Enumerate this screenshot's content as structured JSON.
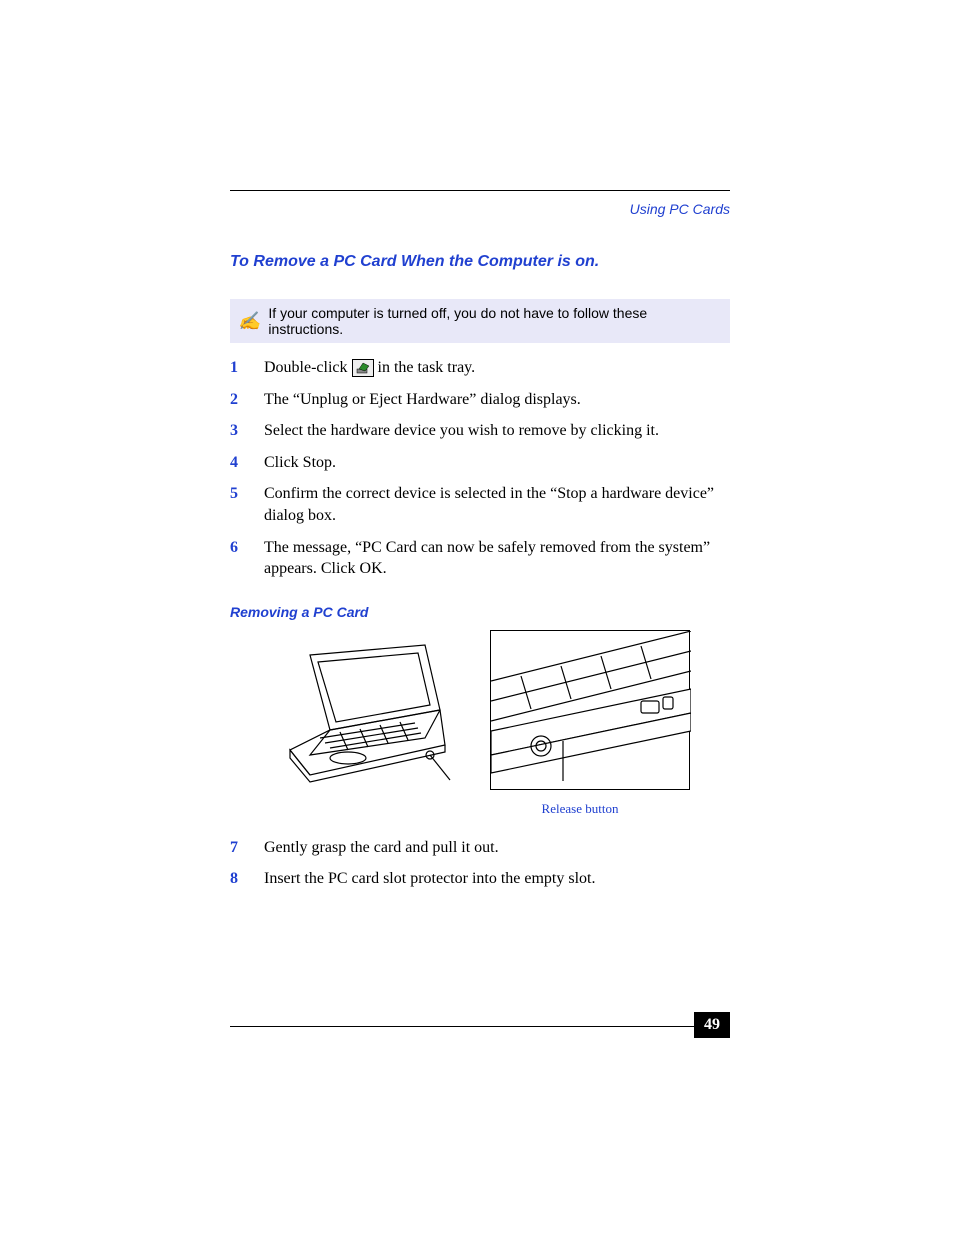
{
  "header": {
    "section": "Using PC Cards"
  },
  "title": "To Remove a PC Card When the Computer is on.",
  "note": {
    "icon": "✍",
    "text": "If your computer is turned off, you do not have to follow these instructions."
  },
  "steps": [
    {
      "n": "1",
      "pre": "Double-click ",
      "post": " in the task tray.",
      "icon": "eject-hardware-icon"
    },
    {
      "n": "2",
      "text": "The “Unplug or Eject Hardware” dialog displays."
    },
    {
      "n": "3",
      "text": "Select the hardware device you wish to remove by clicking it."
    },
    {
      "n": "4",
      "text": "Click Stop."
    },
    {
      "n": "5",
      "text": "Confirm the correct device is selected in the “Stop a hardware device” dialog box."
    },
    {
      "n": "6",
      "text": "The message, “PC Card can now be safely removed from the system” appears. Click OK."
    }
  ],
  "subheading": "Removing a PC Card",
  "figure": {
    "caption": "Release button"
  },
  "steps2": [
    {
      "n": "7",
      "text": "Gently grasp the card and pull it out."
    },
    {
      "n": "8",
      "text": "Insert the PC card slot protector into the empty slot."
    }
  ],
  "page_number": "49"
}
